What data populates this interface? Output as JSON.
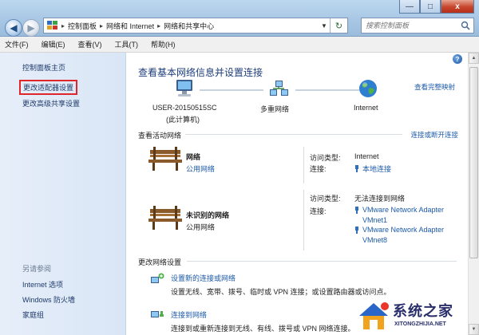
{
  "window": {
    "minimize": "—",
    "maximize": "□",
    "close": "x"
  },
  "address_bar": {
    "breadcrumbs": [
      "控制面板",
      "网络和 Internet",
      "网络和共享中心"
    ]
  },
  "search": {
    "placeholder": "搜索控制面板"
  },
  "menu": [
    "文件(F)",
    "编辑(E)",
    "查看(V)",
    "工具(T)",
    "帮助(H)"
  ],
  "sidebar": {
    "items": [
      {
        "label": "控制面板主页"
      },
      {
        "label": "更改适配器设置",
        "active": true
      },
      {
        "label": "更改高级共享设置"
      }
    ],
    "see_also_title": "另请参阅",
    "see_also": [
      {
        "label": "Internet 选项"
      },
      {
        "label": "Windows 防火墙"
      },
      {
        "label": "家庭组"
      }
    ]
  },
  "main": {
    "title": "查看基本网络信息并设置连接",
    "full_map_link": "查看完整映射",
    "map": [
      {
        "label": "USER-20150515SC",
        "sublabel": "(此计算机)",
        "icon": "computer-icon"
      },
      {
        "label": "多重网络",
        "icon": "network-icon"
      },
      {
        "label": "Internet",
        "icon": "globe-icon"
      }
    ],
    "active_networks": {
      "heading": "查看活动网络",
      "link": "连接或断开连接",
      "networks": [
        {
          "name": "网络",
          "type": "公用网络",
          "access_type_label": "访问类型:",
          "access_type": "Internet",
          "connections_label": "连接:",
          "connections": [
            "本地连接"
          ]
        },
        {
          "name": "未识别的网络",
          "type": "公用网络",
          "access_type_label": "访问类型:",
          "access_type": "无法连接到网络",
          "connections_label": "连接:",
          "connections": [
            "VMware Network Adapter",
            "VMnet1",
            "VMware Network Adapter",
            "VMnet8"
          ]
        }
      ]
    },
    "change_settings": {
      "heading": "更改网络设置",
      "tasks": [
        {
          "link": "设置新的连接或网络",
          "desc": "设置无线、宽带、拨号、临时或 VPN 连接；或设置路由器或访问点。"
        },
        {
          "link": "连接到网络",
          "desc": "连接到或重新连接到无线、有线、拨号或 VPN 网络连接。"
        }
      ]
    },
    "help_icon": "?"
  },
  "watermark": {
    "title": "系统之家",
    "subtitle": "XITONGZHIJIA.NET"
  },
  "colors": {
    "link": "#1c5aa8",
    "heading": "#1d3d7a",
    "highlight_border": "#e0262b"
  }
}
